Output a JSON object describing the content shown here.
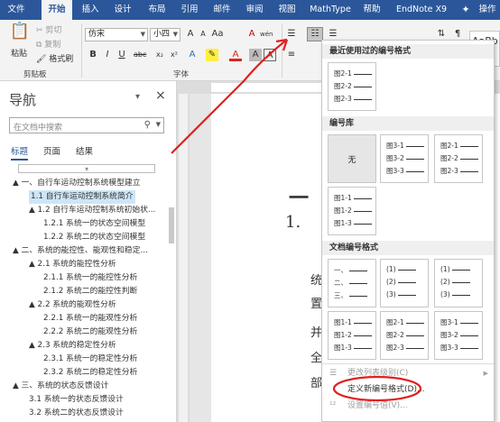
{
  "tabs": [
    "文件",
    "开始",
    "插入",
    "设计",
    "布局",
    "引用",
    "邮件",
    "审阅",
    "视图",
    "MathType",
    "帮助",
    "EndNote X9",
    "操作"
  ],
  "ribbon": {
    "paste": "粘贴",
    "cut": "剪切",
    "copy": "复制",
    "format_painter": "格式刷",
    "clipboard": "剪贴板",
    "font_name": "仿宋",
    "font_size": "小四",
    "font_group": "字体",
    "style_preview": "AaBb",
    "font_color_a": "A",
    "bold": "B",
    "italic": "I",
    "underline": "U",
    "abc": "abc"
  },
  "nav": {
    "title": "导航",
    "close": "×",
    "search_placeholder": "在文档中搜索",
    "tabs": [
      "标题",
      "页面",
      "结果"
    ],
    "items": [
      {
        "label": "▲ 一、自行车运动控制系统模型建立",
        "level": 0
      },
      {
        "label": "1.1 自行车运动控制系统简介",
        "level": 1,
        "selected": true
      },
      {
        "label": "▲ 1.2 自行车运动控制系统初始状...",
        "level": 1
      },
      {
        "label": "1.2.1 系统一的状态空间模型",
        "level": 2
      },
      {
        "label": "1.2.2 系统二的状态空间模型",
        "level": 2
      },
      {
        "label": "▲ 二、系统的能控性、能观性和稳定...",
        "level": 0
      },
      {
        "label": "▲ 2.1 系统的能控性分析",
        "level": 1
      },
      {
        "label": "2.1.1 系统一的能控性分析",
        "level": 2
      },
      {
        "label": "2.1.2 系统二的能控性判断",
        "level": 2
      },
      {
        "label": "▲ 2.2 系统的能观性分析",
        "level": 1
      },
      {
        "label": "2.2.1 系统一的能观性分析",
        "level": 2
      },
      {
        "label": "2.2.2 系统二的能观性分析",
        "level": 2
      },
      {
        "label": "▲ 2.3 系统的稳定性分析",
        "level": 1
      },
      {
        "label": "2.3.1 系统一的稳定性分析",
        "level": 2
      },
      {
        "label": "2.3.2 系统二的稳定性分析",
        "level": 2
      },
      {
        "label": "▲ 三、系统的状态反馈设计",
        "level": 0
      },
      {
        "label": "3.1 系统一的状态反馈设计",
        "level": 1
      },
      {
        "label": "3.2 系统二的状态反馈设计",
        "level": 1
      }
    ]
  },
  "doc": {
    "heading1": "一",
    "heading2": "1.",
    "lines": [
      "统",
      "置",
      "并",
      "全",
      "部"
    ]
  },
  "menu": {
    "recent_header": "最近使用过的编号格式",
    "library_header": "编号库",
    "doc_header": "文档编号格式",
    "none_label": "无",
    "recent": [
      [
        "图2-1",
        "图2-2",
        "图2-3"
      ]
    ],
    "library": [
      [
        "图3-1",
        "图3-2",
        "图3-3"
      ],
      [
        "图2-1",
        "图2-2",
        "图2-3"
      ],
      [
        "图1-1",
        "图1-2",
        "图1-3"
      ]
    ],
    "docfmt": [
      [
        "一、",
        "二、",
        "三、"
      ],
      [
        "(1)",
        "(2)",
        "(3)"
      ],
      [
        "(1)",
        "(2)",
        "(3)"
      ],
      [
        "图1-1",
        "图1-2",
        "图1-3"
      ],
      [
        "图2-1",
        "图2-2",
        "图2-3"
      ],
      [
        "图3-1",
        "图3-2",
        "图3-3"
      ]
    ],
    "change_level": "更改列表级别(C)",
    "define_new": "定义新编号格式(D)...",
    "set_value": "设置编号值(V)..."
  },
  "colors": {
    "accent": "#2b579a",
    "annotation": "#e02020",
    "highlight": "#cde6f7"
  }
}
